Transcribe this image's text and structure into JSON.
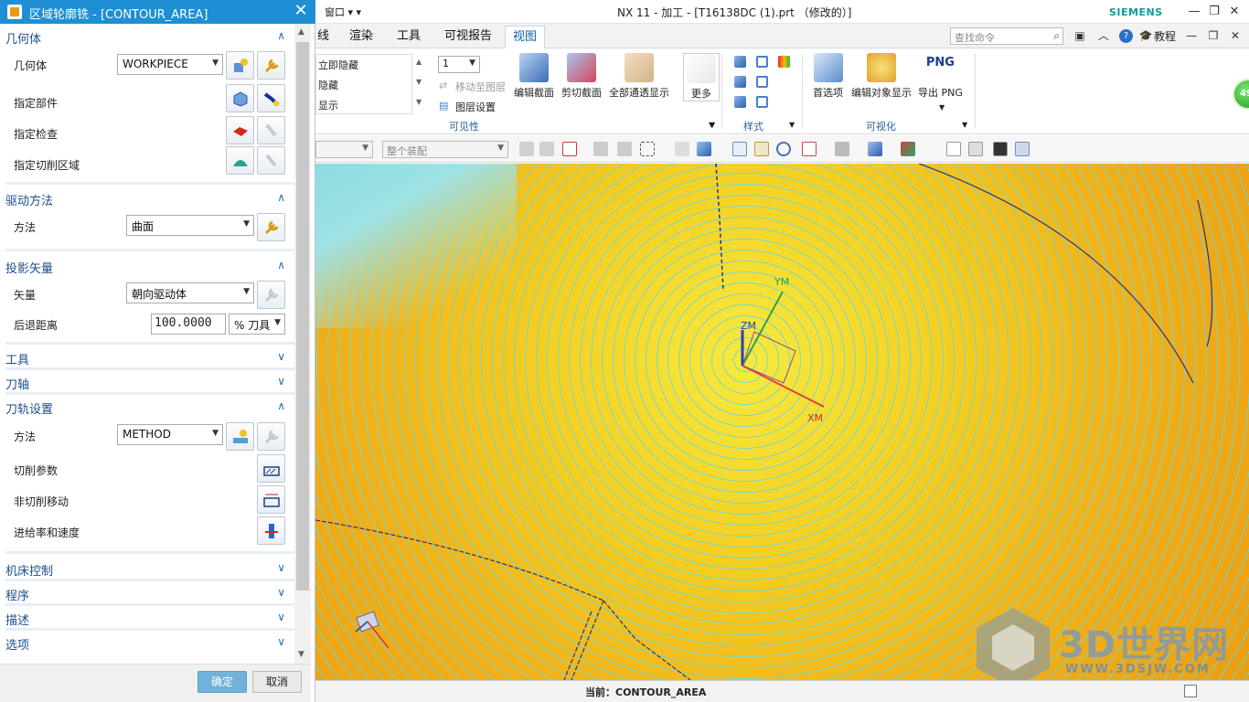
{
  "dialog": {
    "title": "区域轮廓铣 - [CONTOUR_AREA]",
    "close_glyph": "✕",
    "sections": {
      "geometry": {
        "title": "几何体",
        "geometry_label": "几何体",
        "geometry_value": "WORKPIECE",
        "part_label": "指定部件",
        "check_label": "指定检查",
        "trim_label": "指定切削区域"
      },
      "drive": {
        "title": "驱动方法",
        "method_label": "方法",
        "method_value": "曲面"
      },
      "projection": {
        "title": "投影矢量",
        "vector_label": "矢量",
        "vector_value": "朝向驱动体",
        "retract_label": "后退距离",
        "retract_value": "100.0000",
        "retract_unit": "% 刀具"
      },
      "tool": {
        "title": "工具"
      },
      "axis": {
        "title": "刀轴"
      },
      "path": {
        "title": "刀轨设置",
        "method_label": "方法",
        "method_value": "METHOD",
        "cut_params": "切削参数",
        "non_cut": "非切削移动",
        "feeds": "进给率和速度"
      },
      "machine": {
        "title": "机床控制"
      },
      "program": {
        "title": "程序"
      },
      "description": {
        "title": "描述"
      },
      "options": {
        "title": "选项"
      }
    },
    "chevron_up": "∧",
    "chevron_down": "∨",
    "ok_label": "确定",
    "cancel_label": "取消"
  },
  "titlebar": {
    "window_menu": "窗口 ▾ ▾",
    "title": "NX 11 - 加工 - [T16138DC (1).prt （修改的）]",
    "brand": "SIEMENS",
    "min": "—",
    "restore": "❐",
    "close": "✕"
  },
  "tabs": [
    "线",
    "渲染",
    "工具",
    "可视报告",
    "视图"
  ],
  "tabrow": {
    "search_placeholder": "查找命令",
    "tutorial": "教程"
  },
  "ribbon": {
    "visibility": {
      "items": [
        "立即隐藏",
        "隐藏",
        "显示"
      ],
      "layer_value": "1",
      "move_to_layer": "移动至图层",
      "layer_settings": "图层设置",
      "group": "可见性"
    },
    "buttons": [
      "编辑截面",
      "剪切截面",
      "全部通透显示",
      "更多"
    ],
    "style_group": "样式",
    "viz": {
      "buttons": [
        "首选项",
        "编辑对象显示",
        "导出 PNG"
      ],
      "png_icon_text": "PNG",
      "group": "可视化"
    }
  },
  "toolbar2": {
    "filter": "",
    "assembly": "整个装配"
  },
  "viewport": {
    "axes": {
      "x": "XM",
      "y": "YM",
      "z": "ZM"
    }
  },
  "status": {
    "text": "当前：CONTOUR_AREA"
  },
  "badge": "49",
  "watermark": {
    "title": "3D世界网",
    "url": "WWW.3DSJW.COM"
  },
  "colors": {
    "dialog_title": "#1e8fd4",
    "section_text": "#1b4f8a",
    "siemens": "#0a9c9c",
    "ok": "#6fb3d8"
  }
}
